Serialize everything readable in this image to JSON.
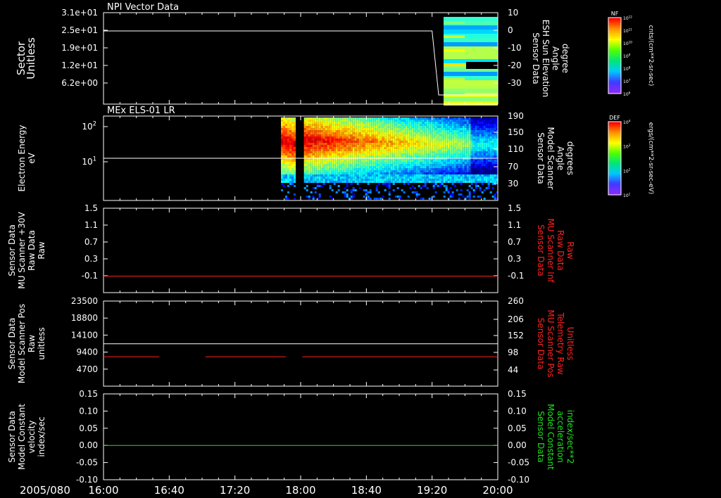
{
  "chart_data": {
    "date": "2005/080",
    "x_ticks": [
      "16:00",
      "16:40",
      "17:20",
      "18:00",
      "18:40",
      "19:20",
      "20:00"
    ],
    "panels": [
      {
        "id": "npi",
        "type": "heatmap",
        "title": "NPI Vector Data",
        "ylabel_left": [
          "Sector",
          "Unitless"
        ],
        "yticks_left": [
          "3.1e+01",
          "2.5e+01",
          "1.9e+01",
          "1.2e+01",
          "6.2e+00"
        ],
        "ylabel_right": [
          "Sensor Data",
          "ESH Sun Elevation",
          "Angle",
          "degree"
        ],
        "yticks_right": [
          "10",
          "0",
          "-10",
          "-20",
          "-30"
        ],
        "ylim_right": [
          -40,
          10
        ],
        "line": {
          "color": "#ffffff",
          "x": [
            "16:00",
            "19:20",
            "19:24",
            "20:00"
          ],
          "y": [
            0,
            0,
            -35,
            -35
          ]
        },
        "data_start": "19:27",
        "colorbar": {
          "label": "NF",
          "unit": "cnts/(cm**2-sr-sec)",
          "ticks": [
            "10^12",
            "10^11",
            "10^10",
            "10^9",
            "10^8",
            "10^7",
            "10^6"
          ]
        }
      },
      {
        "id": "els",
        "type": "heatmap",
        "title": "MEx ELS-01 LR",
        "ylabel_left": [
          "Electron Energy",
          "eV"
        ],
        "yticks_left": [
          "10^2",
          "10^1"
        ],
        "ylabel_right": [
          "Sensor Data",
          "Model Scanner",
          "Angle",
          "degrees"
        ],
        "yticks_right": [
          "190",
          "150",
          "110",
          "70",
          "30"
        ],
        "ylim_right": [
          0,
          190
        ],
        "line": {
          "color": "#ffffff",
          "value": 95
        },
        "data_segments": [
          [
            "17:48",
            "17:57"
          ],
          [
            "18:02",
            "20:00"
          ]
        ],
        "colorbar": {
          "label": "DEF",
          "unit": "ergs/(cm**2-sr-sec-eV)",
          "ticks": [
            "10^4",
            "10^3",
            "10^2",
            "10^1"
          ]
        }
      },
      {
        "id": "mu30",
        "type": "line",
        "ylabel_left": [
          "Sensor Data",
          "MU Scanner +30V",
          "Raw Data",
          "Raw"
        ],
        "yticks_left": [
          "1.5",
          "1.1",
          "0.7",
          "0.3",
          "-0.1"
        ],
        "ylim_left": [
          -0.3,
          1.5
        ],
        "ylabel_right": [
          "Sensor Data",
          "MU Scanner Inf",
          "Raw Data",
          "Raw"
        ],
        "right_color": "#ff2020",
        "yticks_right": [
          "1.5",
          "1.1",
          "0.7",
          "0.3",
          "-0.1"
        ],
        "series": [
          {
            "color": "#ff2020",
            "segments": [
              [
                [
                  "16:00",
                  0.05
                ],
                [
                  "20:00",
                  0.05
                ]
              ]
            ]
          }
        ]
      },
      {
        "id": "scanpos",
        "type": "line",
        "ylabel_left": [
          "Sensor Data",
          "Model Scanner Pos",
          "Raw",
          "unitless"
        ],
        "yticks_left": [
          "23500",
          "18800",
          "14100",
          "9400",
          "4700"
        ],
        "ylim_left": [
          0,
          23500
        ],
        "ylabel_right": [
          "Sensor Data",
          "MU Scanner Pos",
          "Telemetry Raw",
          "Unitless"
        ],
        "right_color": "#ff2020",
        "yticks_right": [
          "260",
          "206",
          "152",
          "98",
          "44"
        ],
        "series": [
          {
            "color": "#ffffff",
            "segments": [
              [
                [
                  "16:00",
                  11700
                ],
                [
                  "20:00",
                  11700
                ]
              ]
            ]
          },
          {
            "color": "#ff2020",
            "segments": [
              [
                [
                  "16:00",
                  8100
                ],
                [
                  "16:34",
                  8100
                ]
              ],
              [
                [
                  "17:02",
                  8100
                ],
                [
                  "17:51",
                  8100
                ]
              ],
              [
                [
                  "18:01",
                  8100
                ],
                [
                  "20:00",
                  8100
                ]
              ]
            ]
          }
        ]
      },
      {
        "id": "velocity",
        "type": "line",
        "ylabel_left": [
          "Sensor Data",
          "Model Constant",
          "velocity",
          "index/sec"
        ],
        "yticks_left": [
          "0.15",
          "0.10",
          "0.05",
          "0.00",
          "-0.05",
          "-0.10"
        ],
        "ylim_left": [
          -0.1,
          0.15
        ],
        "ylabel_right": [
          "Sensor Data",
          "Model Constant",
          "acceleration",
          "index/sec**2"
        ],
        "right_color": "#20e020",
        "yticks_right": [
          "0.15",
          "0.10",
          "0.05",
          "0.00",
          "-0.05",
          "-0.10"
        ],
        "series": [
          {
            "color": "#20e020",
            "segments": [
              [
                [
                  "16:00",
                  0.0
                ],
                [
                  "20:00",
                  0.0
                ]
              ]
            ]
          }
        ]
      }
    ]
  }
}
